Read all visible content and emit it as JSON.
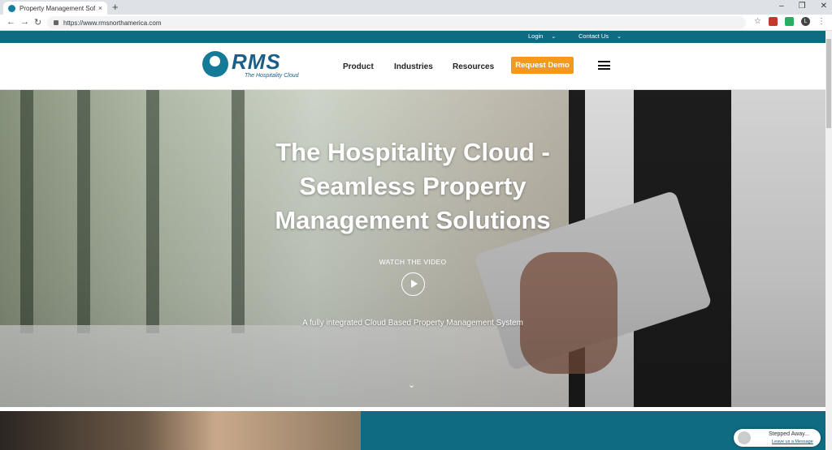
{
  "browser": {
    "tab_title": "Property Management Software",
    "tab_close": "×",
    "new_tab": "+",
    "url": "https://www.rmsnorthamerica.com",
    "avatar_letter": "L",
    "window_controls": [
      "–",
      "❐",
      "✕"
    ]
  },
  "topbar": {
    "login": "Login",
    "contact": "Contact Us",
    "chevron": "⌄"
  },
  "nav": {
    "logo_text": "RMS",
    "logo_tagline": "The Hospitality Cloud",
    "items": [
      "Product",
      "Industries",
      "Resources"
    ],
    "cta": "Request Demo"
  },
  "hero": {
    "title": "The Hospitality Cloud - Seamless Property Management Solutions",
    "watch_label": "WATCH THE VIDEO",
    "subtitle": "A fully integrated Cloud Based Property Management System",
    "scroll_indicator": "⌄"
  },
  "chat": {
    "title": "Stepped Away...",
    "link": "Leave us a Message"
  },
  "colors": {
    "brand_teal": "#0f6b82",
    "cta_orange": "#f39a1e",
    "logo_blue": "#1b5f86"
  }
}
